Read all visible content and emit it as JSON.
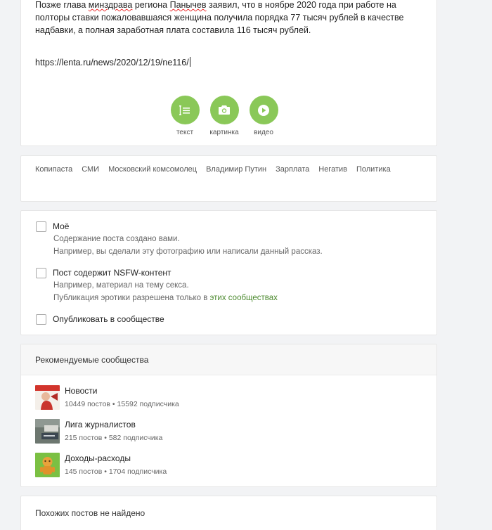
{
  "editor": {
    "text_part1": "Позже глава ",
    "text_misspell1": "минздрава",
    "text_part2": " региона ",
    "text_misspell2": "Панычев",
    "text_part3": " заявил, что в ноябре 2020 года при работе на полторы ставки пожаловавшаяся женщина получила порядка 77 тысяч рублей в качестве надбавки, а полная заработная плата составила 116 тысяч рублей.",
    "link": "https://lenta.ru/news/2020/12/19/ne116/",
    "buttons": [
      {
        "label": "текст",
        "icon": "text-icon"
      },
      {
        "label": "картинка",
        "icon": "camera-icon"
      },
      {
        "label": "видео",
        "icon": "play-icon"
      }
    ],
    "accent_color": "#8ac858"
  },
  "tags": [
    "Копипаста",
    "СМИ",
    "Московский комсомолец",
    "Владимир Путин",
    "Зарплата",
    "Негатив",
    "Политика"
  ],
  "options": {
    "mine": {
      "title": "Моё",
      "desc1": "Содержание поста создано вами.",
      "desc2": "Например, вы сделали эту фотографию или написали данный рассказ."
    },
    "nsfw": {
      "title": "Пост содержит NSFW-контент",
      "desc1": "Например, материал на тему секса.",
      "desc2_prefix": "Публикация эротики разрешена только в ",
      "desc2_link": "этих сообществах"
    },
    "community": {
      "title": "Опубликовать в сообществе"
    }
  },
  "recommended": {
    "title": "Рекомендуемые сообщества",
    "items": [
      {
        "name": "Новости",
        "stats": "10449 постов • 15592 подписчика"
      },
      {
        "name": "Лига журналистов",
        "stats": "215 постов • 582 подписчика"
      },
      {
        "name": "Доходы-расходы",
        "stats": "145 постов • 1704 подписчика"
      }
    ]
  },
  "similar": {
    "text": "Похожих постов не найдено"
  }
}
